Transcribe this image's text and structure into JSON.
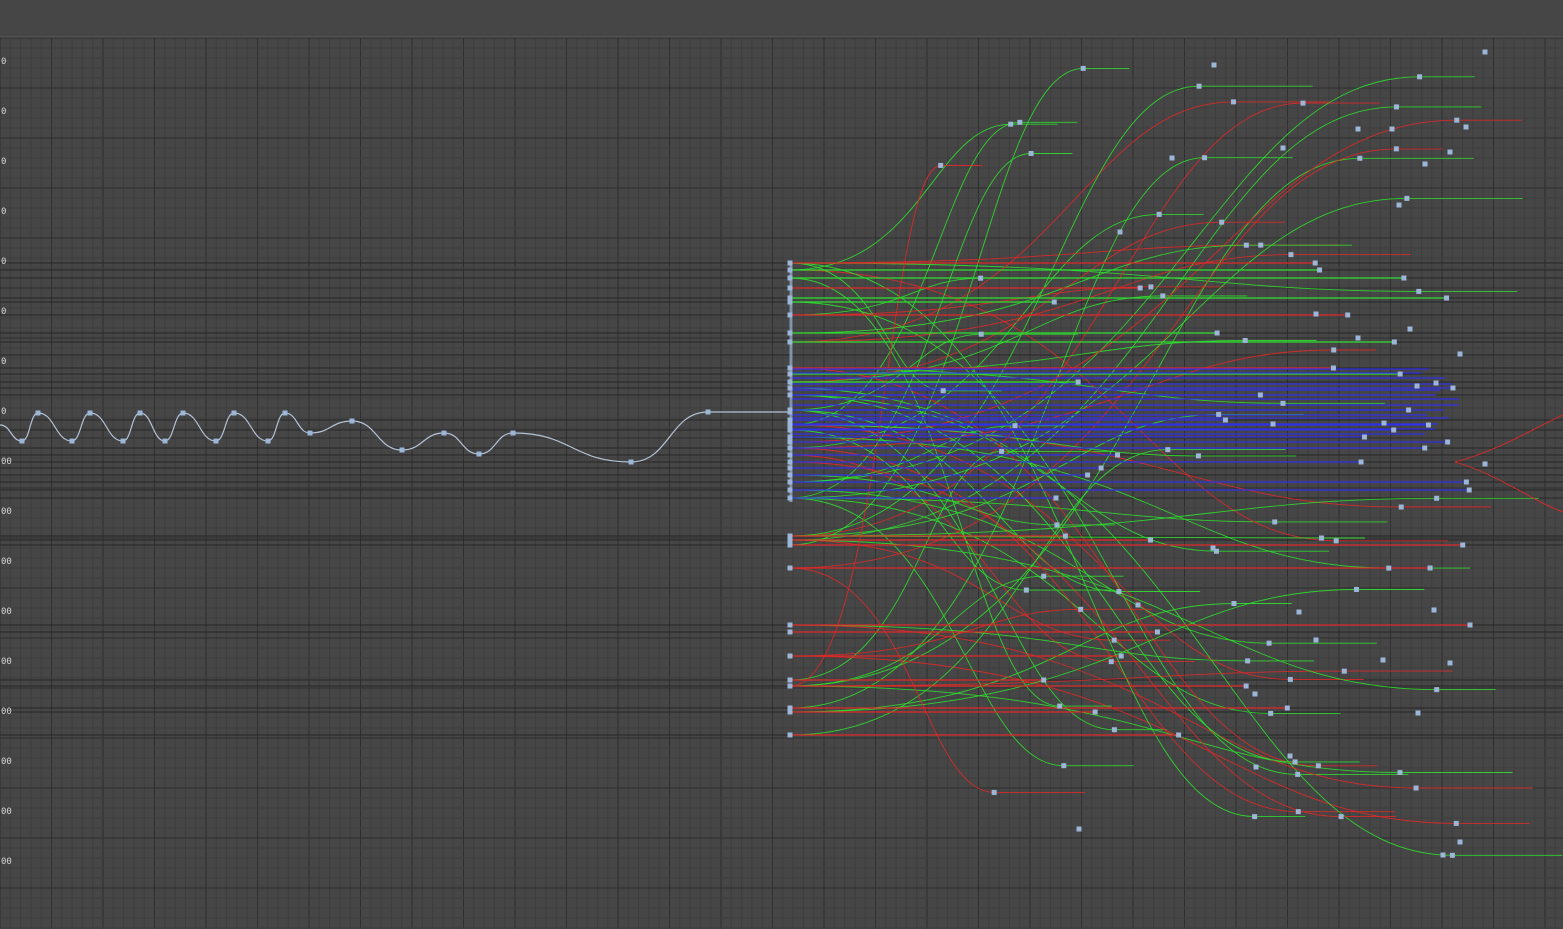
{
  "colors": {
    "background": "#464646",
    "grid_minor": "#3e3e3e",
    "grid_major": "#2f2f2f",
    "curve_selected": "#b4c3d7",
    "curve_x": "#e02828",
    "curve_y": "#2ee02e",
    "curve_z": "#3030e8",
    "key": "#9cb6d8"
  },
  "y_axis_labels": [
    "0",
    "0",
    "0",
    "0",
    "0",
    "0",
    "0",
    "0",
    "00",
    "00",
    "00",
    "00",
    "00",
    "00",
    "00",
    "00",
    "00"
  ],
  "icons": [
    "keyframe-icon"
  ]
}
